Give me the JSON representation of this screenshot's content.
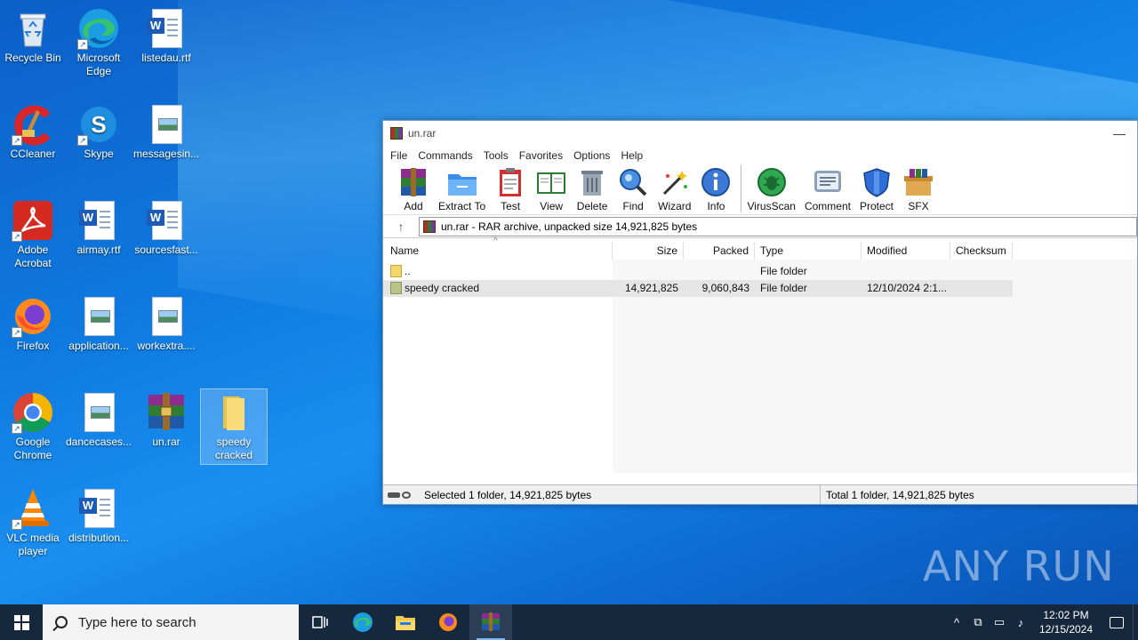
{
  "desktop": {
    "icons": [
      {
        "label": "Recycle Bin",
        "icon": "recycle-bin-icon"
      },
      {
        "label": "Microsoft Edge",
        "icon": "edge-icon"
      },
      {
        "label": "listedau.rtf",
        "icon": "word-doc-icon"
      },
      {
        "label": "CCleaner",
        "icon": "ccleaner-icon"
      },
      {
        "label": "Skype",
        "icon": "skype-icon"
      },
      {
        "label": "messagesin...",
        "icon": "image-file-icon"
      },
      {
        "label": "Adobe Acrobat",
        "icon": "acrobat-icon"
      },
      {
        "label": "airmay.rtf",
        "icon": "word-doc-icon"
      },
      {
        "label": "sourcesfast...",
        "icon": "word-doc-icon"
      },
      {
        "label": "Firefox",
        "icon": "firefox-icon"
      },
      {
        "label": "application...",
        "icon": "image-file-icon"
      },
      {
        "label": "workextra....",
        "icon": "image-file-icon"
      },
      {
        "label": "Google Chrome",
        "icon": "chrome-icon"
      },
      {
        "label": "dancecases...",
        "icon": "image-file-icon"
      },
      {
        "label": "un.rar",
        "icon": "winrar-archive-icon"
      },
      {
        "label": "speedy cracked",
        "icon": "folder-icon"
      },
      {
        "label": "VLC media player",
        "icon": "vlc-icon"
      },
      {
        "label": "distribution...",
        "icon": "word-doc-icon"
      }
    ]
  },
  "window": {
    "title": "un.rar",
    "menu": [
      "File",
      "Commands",
      "Tools",
      "Favorites",
      "Options",
      "Help"
    ],
    "toolbar": [
      "Add",
      "Extract To",
      "Test",
      "View",
      "Delete",
      "Find",
      "Wizard",
      "Info",
      "VirusScan",
      "Comment",
      "Protect",
      "SFX"
    ],
    "path": "un.rar - RAR archive, unpacked size 14,921,825 bytes",
    "columns": [
      "Name",
      "Size",
      "Packed",
      "Type",
      "Modified",
      "Checksum"
    ],
    "rows": [
      {
        "name": "..",
        "size": "",
        "packed": "",
        "type": "File folder",
        "modified": ""
      },
      {
        "name": "speedy cracked",
        "size": "14,921,825",
        "packed": "9,060,843",
        "type": "File folder",
        "modified": "12/10/2024 2:1..."
      }
    ],
    "status_left": "Selected 1 folder, 14,921,825 bytes",
    "status_right": "Total 1 folder, 14,921,825 bytes"
  },
  "taskbar": {
    "search_placeholder": "Type here to search",
    "time": "12:02 PM",
    "date": "12/15/2024"
  },
  "watermark": "ANY RUN"
}
